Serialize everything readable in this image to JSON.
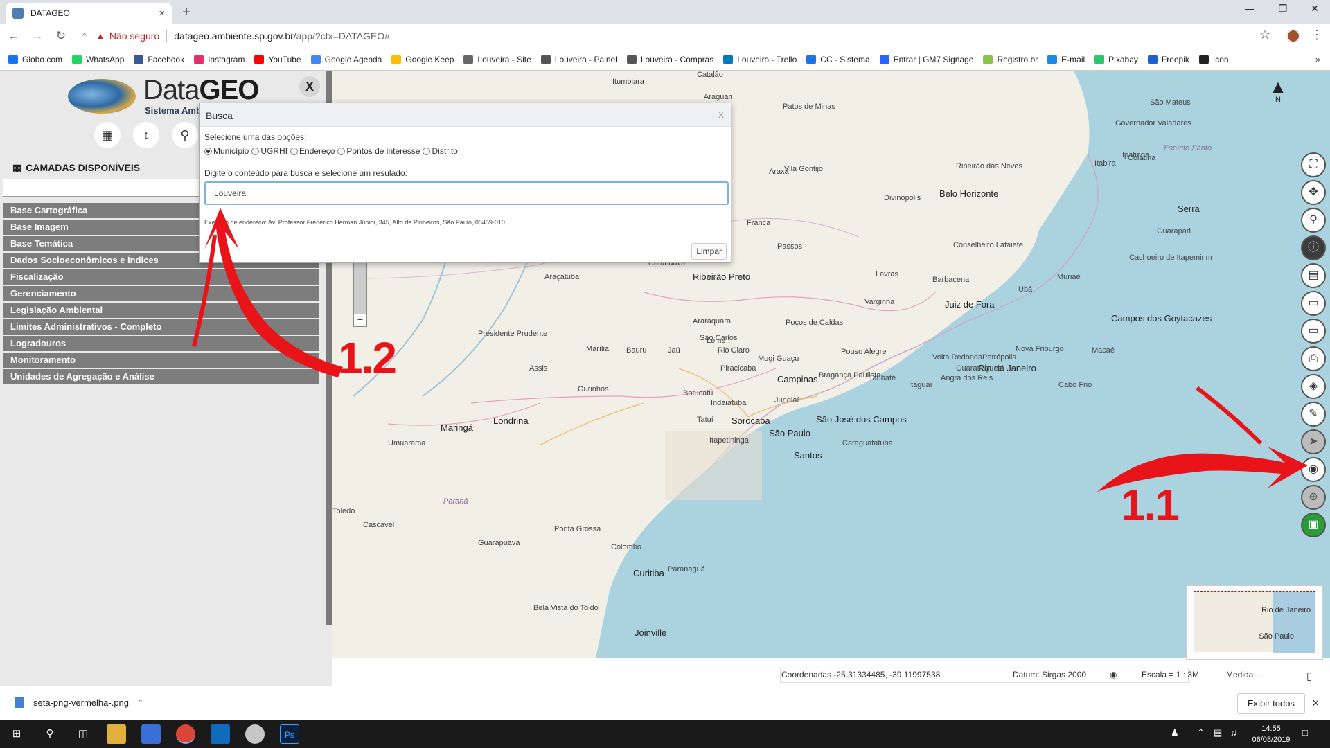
{
  "browser": {
    "tab_title": "DATAGEO",
    "tab_close": "×",
    "new_tab": "+",
    "security_label": "Não seguro",
    "url_host": "datageo.ambiente.sp.gov.br",
    "url_rest": "/app/?ctx=DATAGEO#",
    "bookmarks": [
      "Globo.com",
      "WhatsApp",
      "Facebook",
      "Instagram",
      "YouTube",
      "Google Agenda",
      "Google Keep",
      "Louveira - Site",
      "Louveira - Painel",
      "Louveira - Compras",
      "Louveira - Trello",
      "CC - Sistema",
      "Entrar | GM7 Signage",
      "Registro.br",
      "E-mail",
      "Pixabay",
      "Freepik",
      "Icon"
    ],
    "bookmark_colors": [
      "#1a73e8",
      "#25d366",
      "#3b5998",
      "#e1306c",
      "#ff0000",
      "#4285f4",
      "#fbbc04",
      "#666666",
      "#555555",
      "#555555",
      "#0079bf",
      "#1a73e8",
      "#2962ff",
      "#8bc34a",
      "#1e88e5",
      "#2ec66d",
      "#1c5fce",
      "#222222"
    ],
    "more_bookmarks": "»"
  },
  "sidebar": {
    "logo_light": "Data",
    "logo_bold": "GEO",
    "logo_subtitle": "Sistema Amb",
    "close_label": "X",
    "section_title": "CAMADAS DISPONÍVEIS",
    "layers": [
      "Base Cartográfica",
      "Base Imagem",
      "Base Temática",
      "Dados Socioeconômicos e Índices",
      "Fiscalização",
      "Gerenciamento",
      "Legislação Ambiental",
      "Limites Administrativos - Completo",
      "Logradouros",
      "Monitoramento",
      "Unidades de Agregação e Análise"
    ]
  },
  "dialog": {
    "title": "Busca",
    "close": "x",
    "instruction": "Selecione uma das opções:",
    "options": [
      "Município",
      "UGRHI",
      "Endereço",
      "Pontos de interesse",
      "Distrito"
    ],
    "selected_option": "Município",
    "search_label": "Digite o conteúdo para busca e selecione um resulado:",
    "search_value": "Louveira",
    "example": "Exemplo de endereço: Av. Professor Frederico Herman Júnior, 345, Alto de Pinheiros, São Paulo, 05459-010",
    "clear_button": "Limpar"
  },
  "map": {
    "north_label": "N",
    "zoom_minus": "−",
    "places": [
      "Itumbiara",
      "Catalão",
      "Araguari",
      "Patos de Minas",
      "São Mateus",
      "Governador Valadares",
      "Espírito Santo",
      "Ipatinga",
      "Itabira",
      "Colatina",
      "Araxá",
      "Vila Gontijo",
      "Ribeirão das Neves",
      "Belo Horizonte",
      "Divinópolis",
      "Serra",
      "Guarapari",
      "Franca",
      "Passos",
      "Conselheiro Lafaiete",
      "Cachoeiro de Itapemirim",
      "Lavras",
      "Barbacena",
      "Ubá",
      "Muriaé",
      "Catanduva",
      "Araçatuba",
      "Ribeirão Preto",
      "Varginha",
      "Juiz de Fora",
      "Campos dos Goytacazes",
      "Araraquara",
      "São Carlos",
      "Poços de Caldas",
      "Presidente Prudente",
      "Marília",
      "Bauru",
      "Jaú",
      "Leme",
      "Rio Claro",
      "Mogi Guaçu",
      "Pouso Alegre",
      "Nova Friburgo",
      "Macaé",
      "Volta Redonda",
      "Petrópolis",
      "Rio de Janeiro",
      "Assis",
      "Piracicaba",
      "Campinas",
      "Bragança Paulista",
      "Guaratinguetá",
      "Taubaté",
      "Itaguaí",
      "Cabo Frio",
      "Ourinhos",
      "Botucatu",
      "Indaiatuba",
      "Jundiaí",
      "São José dos Campos",
      "Angra dos Reis",
      "Tatuí",
      "Sorocaba",
      "Maringá",
      "Londrina",
      "Itapetininga",
      "São Paulo",
      "Caraguatatuba",
      "Umuarama",
      "Santos",
      "Paraná",
      "Toledo",
      "Cascavel",
      "Ponta Grossa",
      "Guarapuava",
      "Colombo",
      "Curitiba",
      "Paranaguá",
      "Bela Vista do Toldo",
      "Joinville"
    ],
    "overview_labels": [
      "Rio de Janeiro",
      "São Paulo"
    ],
    "tools": [
      "zoom-extent",
      "pan",
      "zoom",
      "info",
      "document",
      "measure-line",
      "measure-area",
      "print",
      "layers",
      "draw",
      "select",
      "search-location",
      "locate",
      "brazil-map"
    ]
  },
  "statusbar": {
    "coordinates": "Coordenadas -25.31334485, -39.11997538",
    "datum": "Datum: Sirgas 2000",
    "scale": "Escala = 1 : 3M",
    "measure": "Medida ..."
  },
  "annotations": {
    "step_1_1": "1.1",
    "step_1_2": "1.2",
    "color": "#e8141a"
  },
  "downloads": {
    "file": "seta-png-vermelha-.png",
    "show_all": "Exibir todos",
    "close": "×"
  },
  "taskbar": {
    "time": "14:55",
    "date": "06/08/2019"
  }
}
